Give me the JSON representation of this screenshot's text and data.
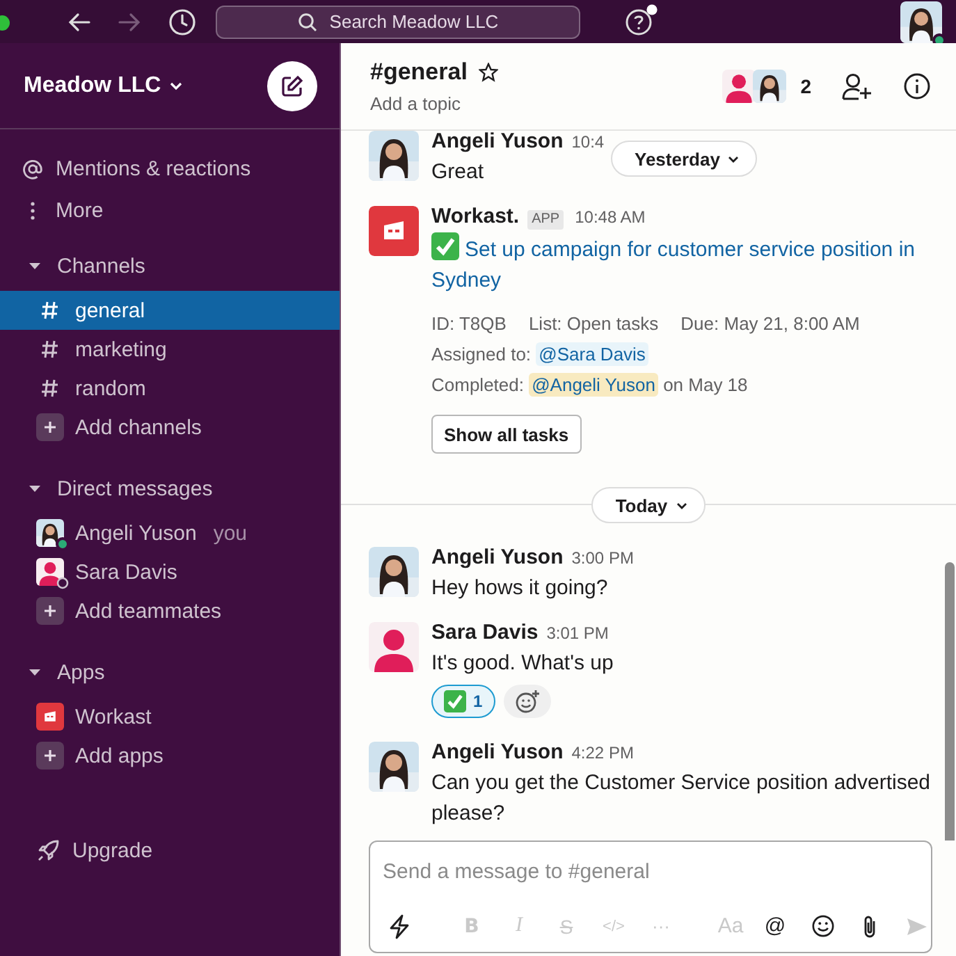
{
  "topbar": {
    "search": {
      "placeholder": "Search Meadow LLC"
    },
    "forward_disabled": true
  },
  "sidebar": {
    "workspace": "Meadow LLC",
    "nav": [
      {
        "kind": "mentions",
        "label": "Mentions & reactions",
        "selected": false
      },
      {
        "kind": "more",
        "label": "More",
        "selected": false
      }
    ],
    "sections": [
      {
        "title": "Channels",
        "expanded": true,
        "items": [
          {
            "kind": "channel",
            "label": "general",
            "selected": true
          },
          {
            "kind": "channel",
            "label": "marketing",
            "selected": false
          },
          {
            "kind": "channel",
            "label": "random",
            "selected": false
          },
          {
            "kind": "add",
            "label": "Add channels",
            "selected": false
          }
        ]
      },
      {
        "title": "Direct messages",
        "expanded": true,
        "items": [
          {
            "kind": "person",
            "avatar": {
              "kind": "photo"
            },
            "label": "Angeli Yuson",
            "note": "you",
            "online": true,
            "selected": false
          },
          {
            "kind": "person",
            "avatar": {
              "kind": "silhouette"
            },
            "label": "Sara Davis",
            "online": false,
            "selected": false
          },
          {
            "kind": "add",
            "label": "Add teammates",
            "selected": false
          }
        ]
      },
      {
        "title": "Apps",
        "expanded": true,
        "items": [
          {
            "kind": "app",
            "avatar": {
              "kind": "workast"
            },
            "label": "Workast",
            "selected": false
          },
          {
            "kind": "add",
            "label": "Add apps",
            "selected": false
          }
        ]
      }
    ],
    "upgrade": "Upgrade"
  },
  "channel_header": {
    "name": "#general",
    "starred": false,
    "topic": "Add a topic",
    "member_count": "2"
  },
  "floating_day": "Yesterday",
  "messages": [
    {
      "kind": "message",
      "avatar": {
        "kind": "photo"
      },
      "author": "Angeli Yuson",
      "time": "10:4",
      "text": "Great"
    },
    {
      "kind": "task",
      "avatar": {
        "kind": "workast"
      },
      "author": "Workast.",
      "badge": "APP",
      "time": "10:48 AM",
      "done": true,
      "task_title": "Set up campaign for customer service position in Sydney",
      "meta": [
        "ID: T8QB",
        "List: Open tasks",
        "Due: May 21, 8:00 AM"
      ],
      "assigned": {
        "label": "Assigned to:",
        "mention": "@Sara Davis",
        "is_you": false
      },
      "completed": {
        "label": "Completed:",
        "mention": "@Angeli Yuson",
        "is_you": true,
        "suffix": "on May 18"
      },
      "button": "Show all tasks"
    },
    {
      "kind": "day_divider",
      "label": "Today"
    },
    {
      "kind": "message",
      "avatar": {
        "kind": "photo"
      },
      "author": "Angeli Yuson",
      "time": "3:00 PM",
      "text": "Hey hows it going?"
    },
    {
      "kind": "message",
      "avatar": {
        "kind": "silhouette"
      },
      "author": "Sara Davis",
      "time": "3:01 PM",
      "text": "It's good. What's up",
      "reactions": [
        {
          "count": "1",
          "reacted": true
        }
      ]
    },
    {
      "kind": "message",
      "avatar": {
        "kind": "photo"
      },
      "author": "Angeli Yuson",
      "time": "4:22 PM",
      "text": "Can you get the Customer Service position advertised please?"
    }
  ],
  "composer": {
    "placeholder": "Send a message to #general",
    "tools": [
      {
        "kind": "shortcut",
        "disabled": false
      },
      {
        "kind": "bold",
        "label": "B",
        "disabled": true
      },
      {
        "kind": "italic",
        "label": "I",
        "disabled": true
      },
      {
        "kind": "strike",
        "label": "S",
        "disabled": true
      },
      {
        "kind": "code",
        "label": "</>",
        "disabled": true
      },
      {
        "kind": "more",
        "label": "···",
        "disabled": true
      },
      {
        "kind": "text_style",
        "label": "Aa",
        "disabled": true
      },
      {
        "kind": "mention",
        "label": "@",
        "disabled": false
      },
      {
        "kind": "emoji",
        "disabled": false
      },
      {
        "kind": "attach",
        "disabled": false
      },
      {
        "kind": "send",
        "disabled": true
      }
    ]
  }
}
